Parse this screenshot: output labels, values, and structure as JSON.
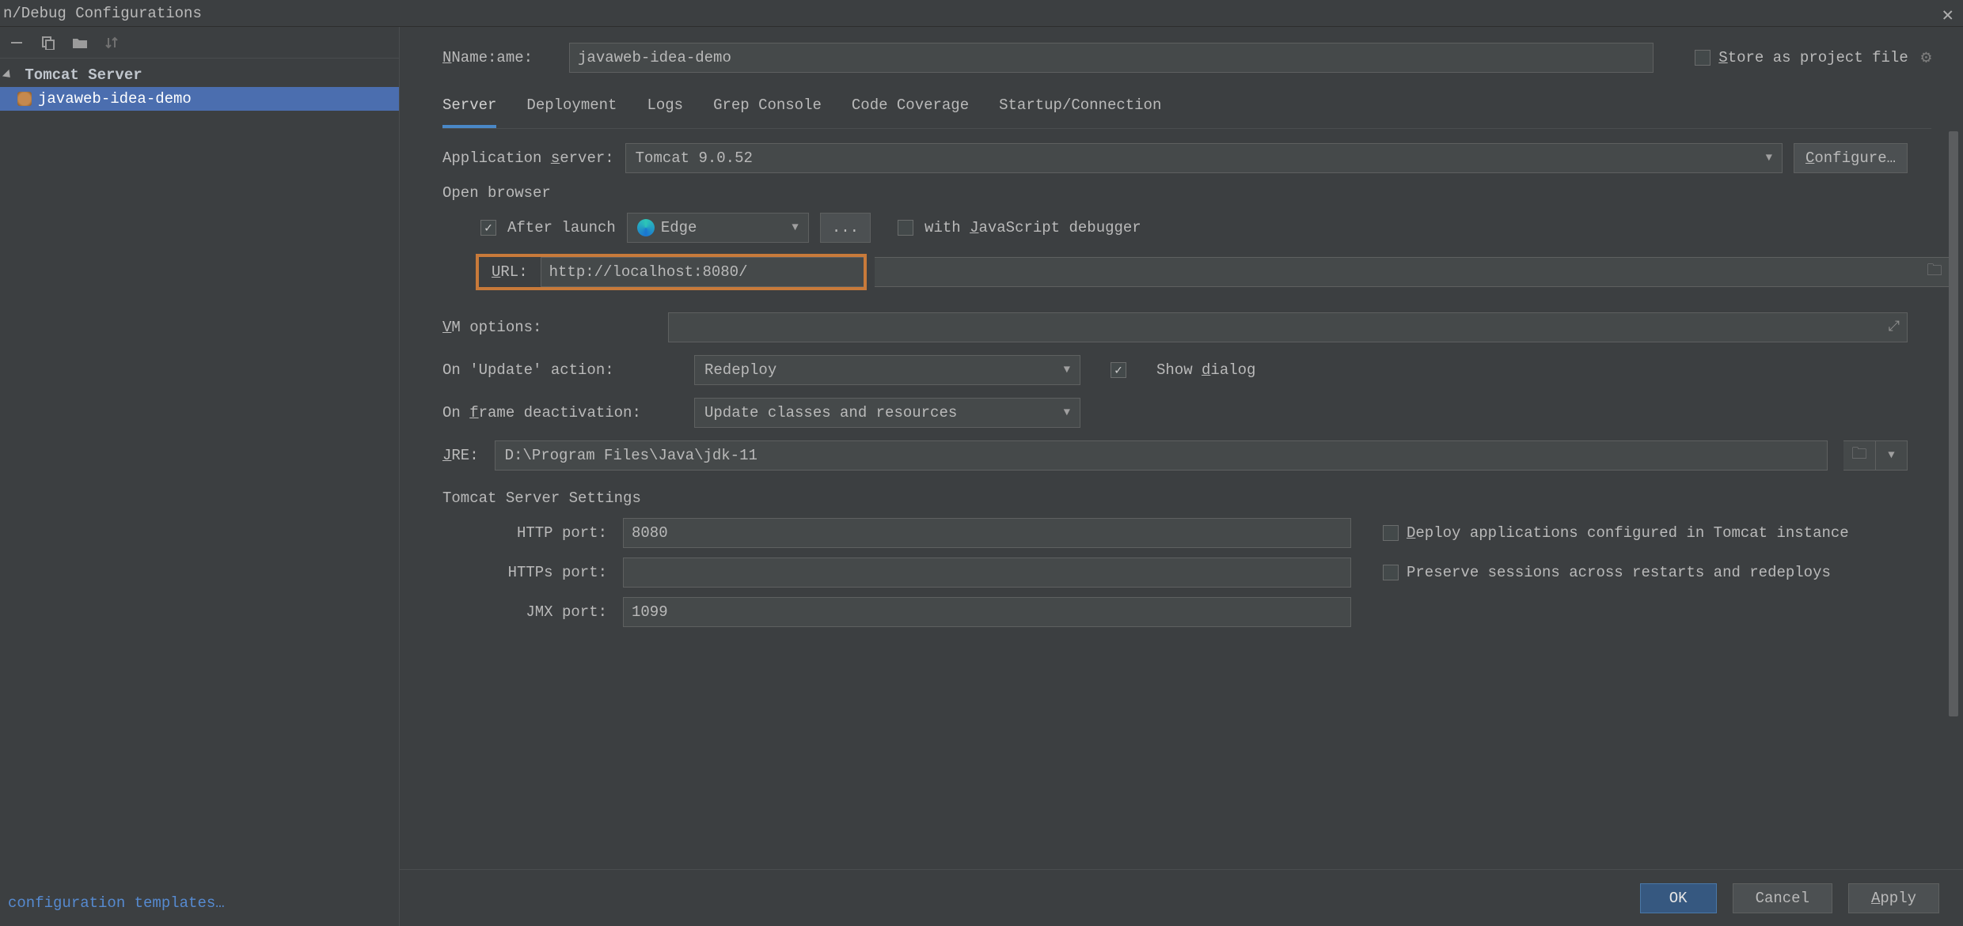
{
  "window": {
    "title": "n/Debug Configurations"
  },
  "sidebar": {
    "root": "Tomcat Server",
    "item": "javaweb-idea-demo",
    "templates_link": "configuration templates…"
  },
  "nameRow": {
    "label": "Name:",
    "value": "javaweb-idea-demo",
    "store_label": "Store as project file"
  },
  "tabs": {
    "server": "Server",
    "deployment": "Deployment",
    "logs": "Logs",
    "grep": "Grep Console",
    "coverage": "Code Coverage",
    "startup": "Startup/Connection"
  },
  "appServer": {
    "label": "Application server:",
    "value": "Tomcat 9.0.52",
    "configure": "Configure…"
  },
  "openBrowser": {
    "section": "Open browser",
    "after_launch": "After launch",
    "browser": "Edge",
    "ellipsis": "...",
    "js_debugger": "with JavaScript debugger",
    "url_label": "URL:",
    "url_value": "http://localhost:8080/"
  },
  "vm": {
    "label": "VM options:"
  },
  "updateAction": {
    "label": "On 'Update' action:",
    "value": "Redeploy",
    "show_dialog": "Show dialog"
  },
  "frameDeact": {
    "label": "On frame deactivation:",
    "value": "Update classes and resources"
  },
  "jre": {
    "label": "JRE:",
    "value": "D:\\Program Files\\Java\\jdk-11"
  },
  "tomcatSettings": {
    "section": "Tomcat Server Settings",
    "http_label": "HTTP port:",
    "http_value": "8080",
    "https_label": "HTTPs port:",
    "https_value": "",
    "jmx_label": "JMX port:",
    "jmx_value": "1099",
    "deploy_apps": "Deploy applications configured in Tomcat instance",
    "preserve_sessions": "Preserve sessions across restarts and redeploys"
  },
  "footer": {
    "ok": "OK",
    "cancel": "Cancel",
    "apply": "Apply"
  }
}
